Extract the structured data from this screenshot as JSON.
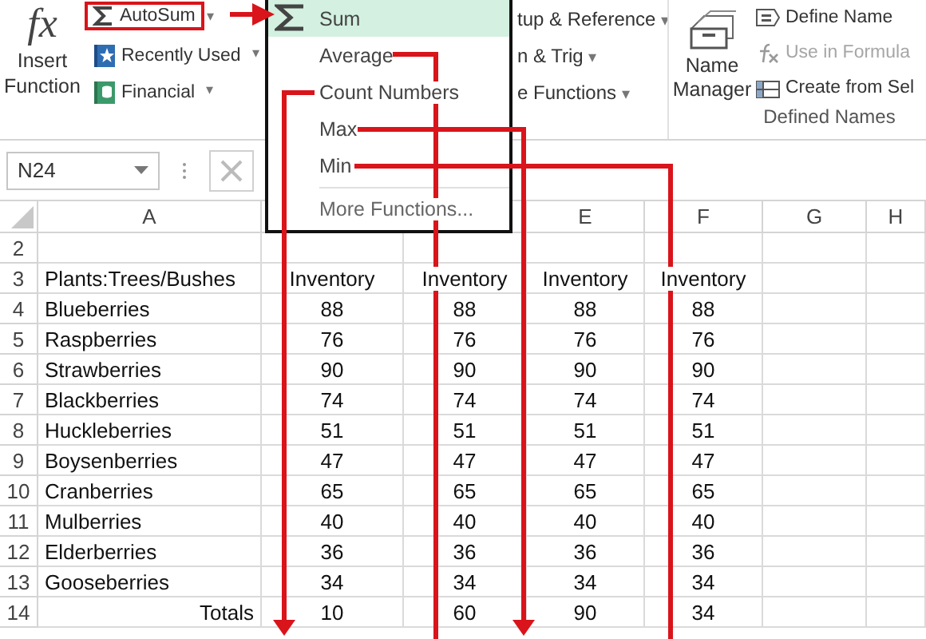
{
  "ribbon": {
    "insert_function": {
      "glyph": "fx",
      "label": "Insert Function"
    },
    "library": [
      {
        "kind": "autosum",
        "label": "AutoSum",
        "caret": "▾",
        "highlighted": true
      },
      {
        "kind": "recent",
        "label": "Recently Used",
        "caret": "▾",
        "highlighted": false
      },
      {
        "kind": "financial",
        "label": "Financial",
        "caret": "▾",
        "highlighted": false
      }
    ],
    "library_partial": [
      {
        "label": "tup & Reference",
        "caret": "▾"
      },
      {
        "label": "n & Trig",
        "caret": "▾"
      },
      {
        "label": "e Functions",
        "caret": "▾"
      }
    ],
    "name_manager": {
      "label": "Name Manager"
    },
    "defined_names": [
      {
        "kind": "define",
        "label": "Define Name",
        "disabled": false
      },
      {
        "kind": "use",
        "label": "Use in Formula",
        "disabled": true
      },
      {
        "kind": "create",
        "label": "Create from Sel",
        "disabled": false
      }
    ],
    "group_label": "Defined Names"
  },
  "formula_bar": {
    "name_box": "N24"
  },
  "autosum_menu": [
    {
      "kind": "sum",
      "label": "Sum",
      "selected": true
    },
    {
      "kind": "item",
      "label": "Average",
      "selected": false
    },
    {
      "kind": "item",
      "label": "Count Numbers",
      "selected": false
    },
    {
      "kind": "item",
      "label": "Max",
      "selected": false
    },
    {
      "kind": "item",
      "label": "Min",
      "selected": false
    },
    {
      "kind": "more",
      "label": "More Functions...",
      "selected": false
    }
  ],
  "columns": [
    {
      "label": "A"
    },
    {},
    {},
    {
      "label": "E"
    },
    {
      "label": "F"
    },
    {
      "label": "G"
    },
    {
      "label": "H"
    }
  ],
  "rows": [
    {
      "number": "2",
      "kind": "blank"
    },
    {
      "number": "3",
      "kind": "header",
      "label": "Plants:Trees/Bushes",
      "values": [
        "Inventory",
        "Inventory",
        "Inventory",
        "Inventory"
      ]
    },
    {
      "number": "4",
      "kind": "data",
      "label": "Blueberries",
      "values": [
        "88",
        "88",
        "88",
        "88"
      ]
    },
    {
      "number": "5",
      "kind": "data",
      "label": "Raspberries",
      "values": [
        "76",
        "76",
        "76",
        "76"
      ]
    },
    {
      "number": "6",
      "kind": "data",
      "label": "Strawberries",
      "values": [
        "90",
        "90",
        "90",
        "90"
      ]
    },
    {
      "number": "7",
      "kind": "data",
      "label": "Blackberries",
      "values": [
        "74",
        "74",
        "74",
        "74"
      ]
    },
    {
      "number": "8",
      "kind": "data",
      "label": "Huckleberries",
      "values": [
        "51",
        "51",
        "51",
        "51"
      ]
    },
    {
      "number": "9",
      "kind": "data",
      "label": "Boysenberries",
      "values": [
        "47",
        "47",
        "47",
        "47"
      ]
    },
    {
      "number": "10",
      "kind": "data",
      "label": "Cranberries",
      "values": [
        "65",
        "65",
        "65",
        "65"
      ]
    },
    {
      "number": "11",
      "kind": "data",
      "label": "Mulberries",
      "values": [
        "40",
        "40",
        "40",
        "40"
      ]
    },
    {
      "number": "12",
      "kind": "data",
      "label": "Elderberries",
      "values": [
        "36",
        "36",
        "36",
        "36"
      ]
    },
    {
      "number": "13",
      "kind": "data",
      "label": "Gooseberries",
      "values": [
        "34",
        "34",
        "34",
        "34"
      ]
    },
    {
      "number": "14",
      "kind": "total",
      "label": "Totals",
      "values": [
        "10",
        "60",
        "90",
        "34"
      ]
    }
  ]
}
